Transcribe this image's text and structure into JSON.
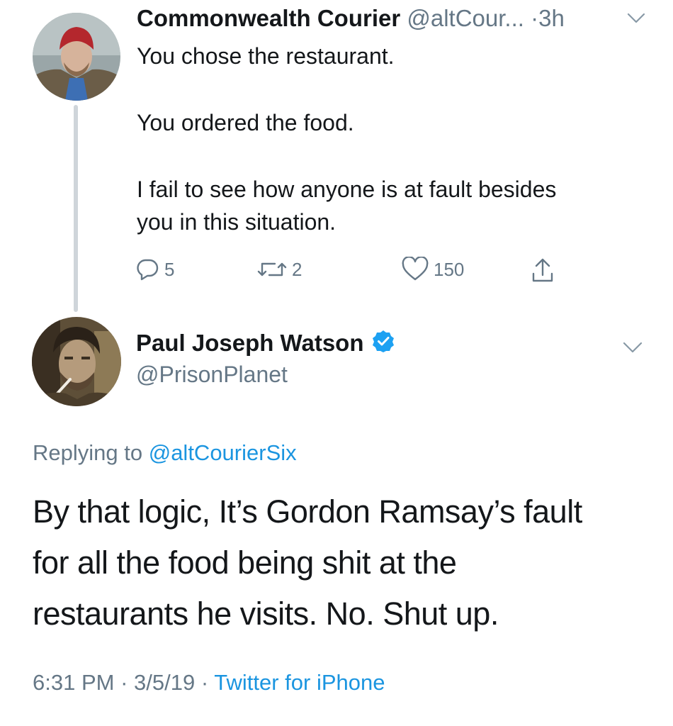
{
  "parent_tweet": {
    "display_name": "Commonwealth Courier",
    "handle": "@altCour...",
    "separator": "·",
    "time_ago": "3h",
    "text_lines": [
      "You chose the restaurant.",
      "You ordered the food.",
      "I fail to see how anyone is at fault besides",
      "you in this situation."
    ],
    "actions": {
      "replies": "5",
      "retweets": "2",
      "likes": "150"
    },
    "icons": [
      "avatar-photo",
      "chevron-down-icon",
      "reply-icon",
      "retweet-icon",
      "like-icon",
      "share-icon"
    ]
  },
  "main_tweet": {
    "display_name": "Paul Joseph Watson",
    "handle": "@PrisonPlanet",
    "verified": true,
    "replying_label": "Replying to",
    "replying_to": "@altCourierSix",
    "text_lines": [
      "By that logic, It’s Gordon Ramsay’s fault",
      "for all the food being shit at the",
      "restaurants he visits. No. Shut up."
    ],
    "time": "6:31 PM",
    "sep1": "·",
    "date": "3/5/19",
    "sep2": "·",
    "source": "Twitter for iPhone"
  },
  "colors": {
    "link": "#1b95e0",
    "secondary_text": "#657786",
    "thread_line": "#cfd5da",
    "verified": "#1da1f2"
  }
}
